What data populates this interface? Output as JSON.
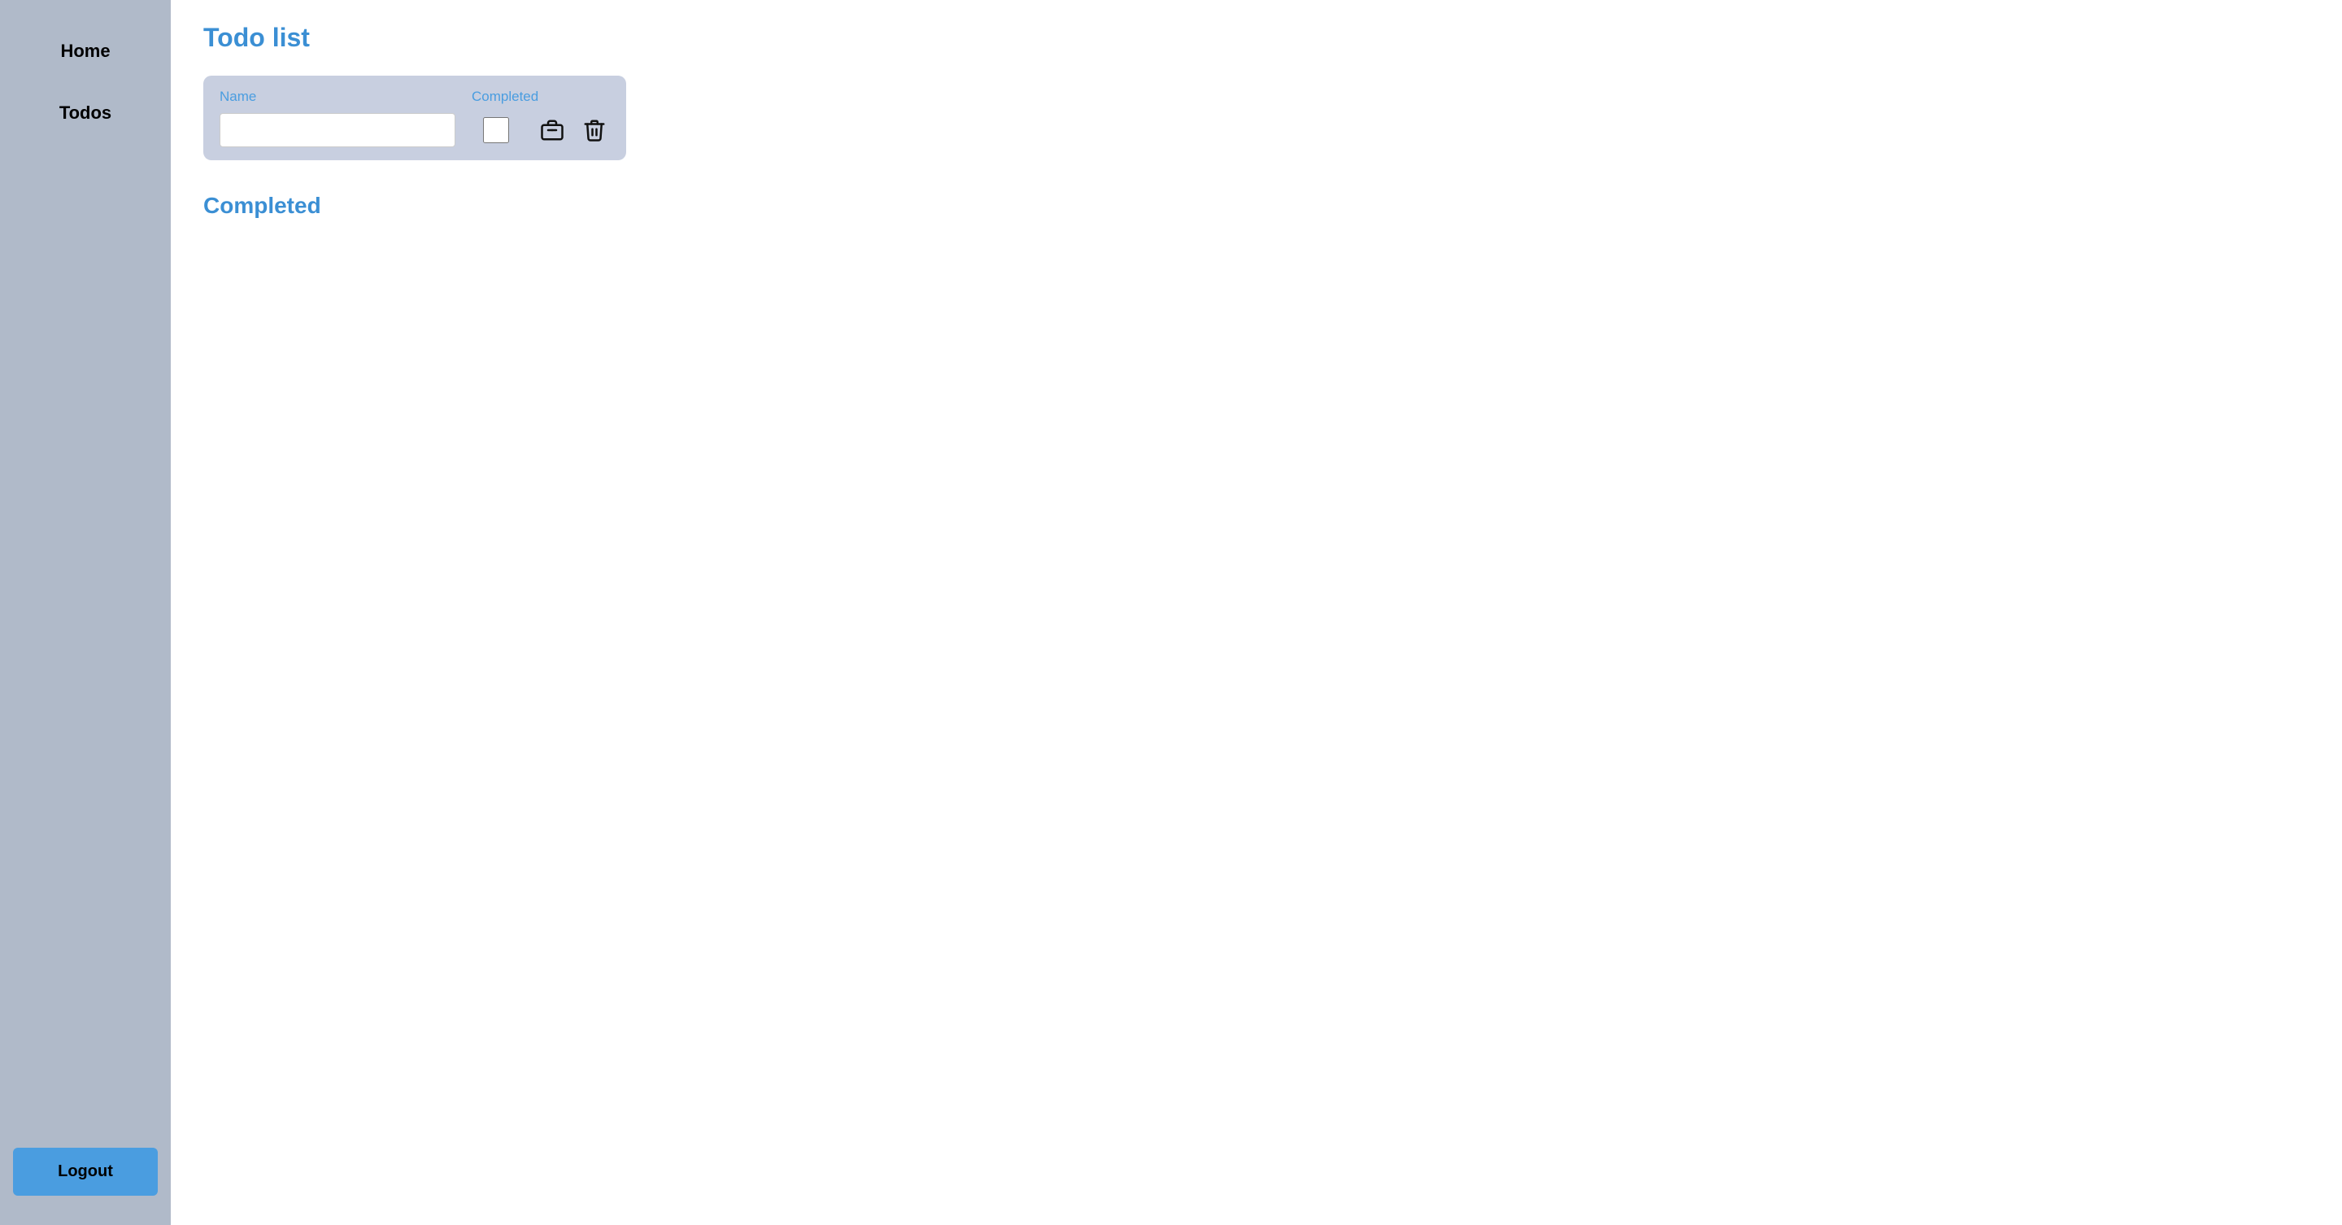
{
  "sidebar": {
    "home_label": "Home",
    "todos_label": "Todos",
    "logout_label": "Logout"
  },
  "main": {
    "page_title": "Todo list",
    "table": {
      "name_header": "Name",
      "completed_header": "Completed",
      "name_placeholder": "",
      "checkbox_checked": false
    },
    "completed_section_title": "Completed"
  },
  "icons": {
    "briefcase": "briefcase-icon",
    "trash": "trash-icon"
  }
}
